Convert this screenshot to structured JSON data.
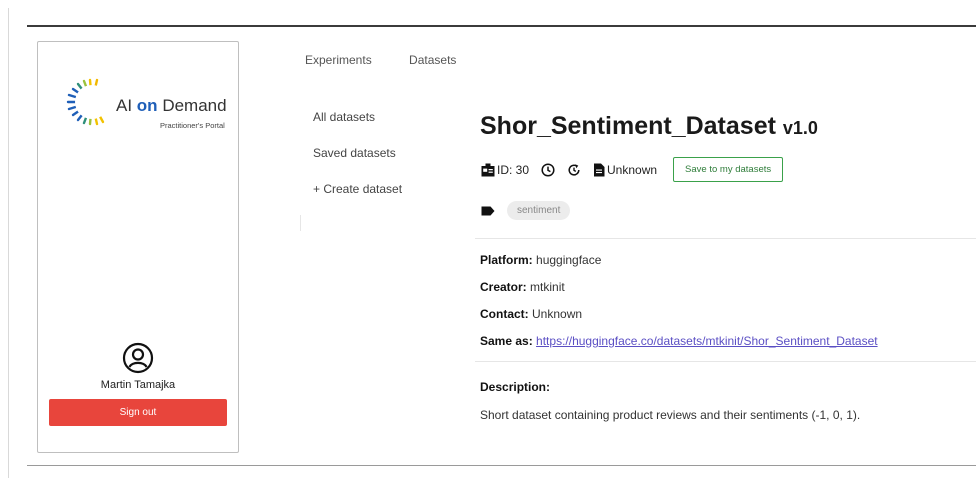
{
  "sidebar": {
    "logo": {
      "title_ai": "AI",
      "title_on": "on",
      "title_demand": "Demand",
      "subtitle": "Practitioner's Portal"
    },
    "user_name": "Martin Tamajka",
    "signout_label": "Sign out"
  },
  "topnav": {
    "items": [
      {
        "label": "Experiments"
      },
      {
        "label": "Datasets"
      }
    ]
  },
  "subnav": {
    "items": [
      {
        "label": "All datasets"
      },
      {
        "label": "Saved datasets"
      },
      {
        "label": "+ Create dataset"
      }
    ]
  },
  "dataset": {
    "name": "Shor_Sentiment_Dataset",
    "version": "v1.0",
    "id_label": "ID: 30",
    "license": "Unknown",
    "save_label": "Save to my datasets",
    "tag": "sentiment",
    "platform_label": "Platform:",
    "platform": "huggingface",
    "creator_label": "Creator:",
    "creator": "mtkinit",
    "contact_label": "Contact:",
    "contact": "Unknown",
    "same_as_label": "Same as:",
    "same_as": "https://huggingface.co/datasets/mtkinit/Shor_Sentiment_Dataset",
    "description_label": "Description:",
    "description": "Short dataset containing product reviews and their sentiments (-1, 0, 1)."
  },
  "colors": {
    "signout": "#e8453c",
    "save_border": "#3aa14a",
    "link": "#5b4fc4",
    "brand_blue": "#1f5fb8"
  }
}
